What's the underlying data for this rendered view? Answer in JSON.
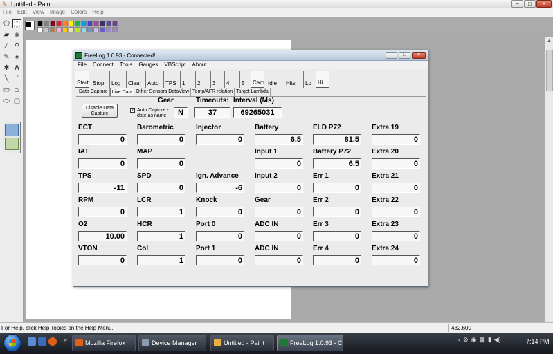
{
  "paint": {
    "title": "Untitled - Paint",
    "menu": [
      "File",
      "Edit",
      "View",
      "Image",
      "Colors",
      "Help"
    ],
    "status_help": "For Help, click Help Topics on the Help Menu.",
    "coords": "432,600"
  },
  "freelog": {
    "title": "FreeLog 1.0.93 - Connected!",
    "menu": [
      "File",
      "Connect",
      "Tools",
      "Gauges",
      "VBScript",
      "About"
    ],
    "buttons": [
      "Start",
      "Stop",
      "Log",
      "Clear",
      "Auto",
      "TPS",
      "1",
      "2",
      "3",
      "4",
      "5",
      "Cam",
      "Idle",
      "Hits",
      "Lo",
      "Hi"
    ],
    "tabs": [
      "Data Capture",
      "Live Data",
      "Other Sensors DataView",
      "Temp/AFR relation",
      "Target Lambda"
    ],
    "disable_button": "Disable Data Capture",
    "auto_capture": {
      "checked": true,
      "label": "Auto Capture - date as name"
    },
    "gear_label": "Gear",
    "gear_value": "N",
    "timeouts_label": "Timeouts:",
    "timeouts_value": "37",
    "interval_label": "Interval (Ms)",
    "interval_value": "69265031",
    "fields": [
      [
        {
          "label": "ECT",
          "value": "0"
        },
        {
          "label": "IAT",
          "value": "0"
        },
        {
          "label": "TPS",
          "value": "-11"
        },
        {
          "label": "RPM",
          "value": "0"
        },
        {
          "label": "O2",
          "value": "10.00"
        },
        {
          "label": "VTON",
          "value": "0"
        }
      ],
      [
        {
          "label": "Barometric",
          "value": "0"
        },
        {
          "label": "MAP",
          "value": "0"
        },
        {
          "label": "SPD",
          "value": "0"
        },
        {
          "label": "LCR",
          "value": "1"
        },
        {
          "label": "HCR",
          "value": "1"
        },
        {
          "label": "Col",
          "value": "1"
        }
      ],
      [
        {
          "label": "Injector",
          "value": "0"
        },
        null,
        {
          "label": "Ign. Advance",
          "value": "-6"
        },
        {
          "label": "Knock",
          "value": "0"
        },
        {
          "label": "Port 0",
          "value": "0"
        },
        {
          "label": "Port 1",
          "value": "0"
        }
      ],
      [
        {
          "label": "Battery",
          "value": "6.5"
        },
        {
          "label": "Input 1",
          "value": "0"
        },
        {
          "label": "Input 2",
          "value": "0"
        },
        {
          "label": "Gear",
          "value": "0"
        },
        {
          "label": "ADC IN",
          "value": "0"
        },
        {
          "label": "ADC IN",
          "value": "0"
        }
      ],
      [
        {
          "label": "ELD P72",
          "value": "81.5"
        },
        {
          "label": "Battery P72",
          "value": "6.5"
        },
        {
          "label": "Err 1",
          "value": "0"
        },
        {
          "label": "Err 2",
          "value": "0"
        },
        {
          "label": "Err 3",
          "value": "0"
        },
        {
          "label": "Err 4",
          "value": "0"
        }
      ],
      [
        {
          "label": "Extra 19",
          "value": "0"
        },
        {
          "label": "Extra 20",
          "value": "0"
        },
        {
          "label": "Extra 21",
          "value": "0"
        },
        {
          "label": "Extra 22",
          "value": "0"
        },
        {
          "label": "Extra 23",
          "value": "0"
        },
        {
          "label": "Extra 24",
          "value": "0"
        }
      ]
    ]
  },
  "taskbar": {
    "items": [
      {
        "label": "Mozilla Firefox",
        "icon": "firefox-icon",
        "color": "#e0601a"
      },
      {
        "label": "Device Manager",
        "icon": "device-manager-icon",
        "color": "#8a9ab0"
      },
      {
        "label": "Untitled - Paint",
        "icon": "paint-icon",
        "color": "#e8b040"
      },
      {
        "label": "FreeLog 1.0.93 - Co...",
        "icon": "freelog-icon",
        "color": "#1c7a35"
      }
    ],
    "clock": "7:14 PM"
  }
}
